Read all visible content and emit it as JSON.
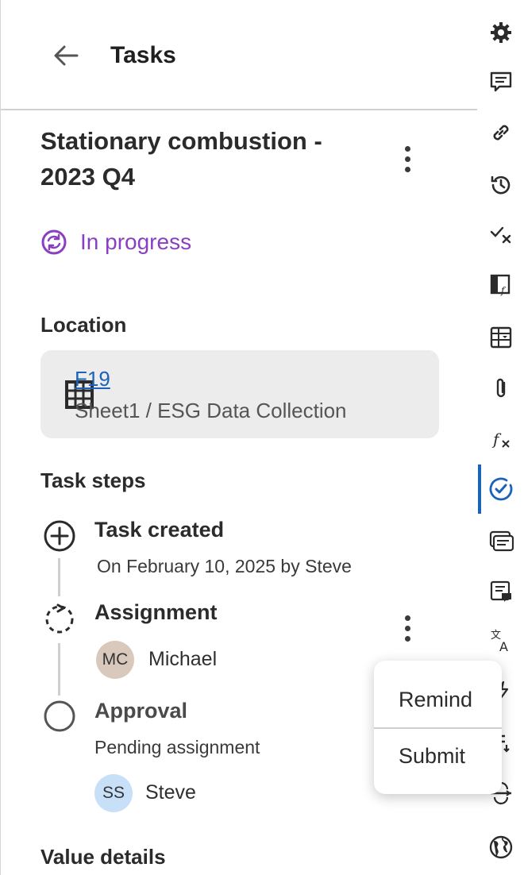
{
  "header": {
    "title": "Tasks"
  },
  "task": {
    "title": "Stationary combustion - 2023 Q4",
    "status": "In progress",
    "status_color": "#8a3fc1"
  },
  "location": {
    "label": "Location",
    "cell": "F19",
    "path": "Sheet1 / ESG Data Collection"
  },
  "steps": {
    "label": "Task steps",
    "items": [
      {
        "title": "Task created",
        "detail": "On February 10, 2025 by Steve"
      },
      {
        "title": "Assignment",
        "assignee_initials": "MC",
        "assignee_name": "Michael"
      },
      {
        "title": "Approval",
        "detail": "Pending assignment",
        "assignee_initials": "SS",
        "assignee_name": "Steve"
      }
    ]
  },
  "value_details": {
    "label": "Value details"
  },
  "menu": {
    "items": [
      "Remind",
      "Submit"
    ]
  },
  "colors": {
    "accent": "#1a63b8",
    "mc_avatar": "#d9c9bd",
    "ss_avatar": "#c7e0f7"
  },
  "rail": {
    "icons": [
      "gear-icon",
      "comment-icon",
      "link-icon",
      "history-icon",
      "check-x-icon",
      "table-formula-icon",
      "table-dropdown-icon",
      "paperclip-icon",
      "fx-icon",
      "task-check-icon",
      "cards-icon",
      "note-comment-icon",
      "translate-icon",
      "flash-icon",
      "list-icon",
      "flow-icon",
      "globe-icon"
    ],
    "active": "task-check-icon"
  }
}
